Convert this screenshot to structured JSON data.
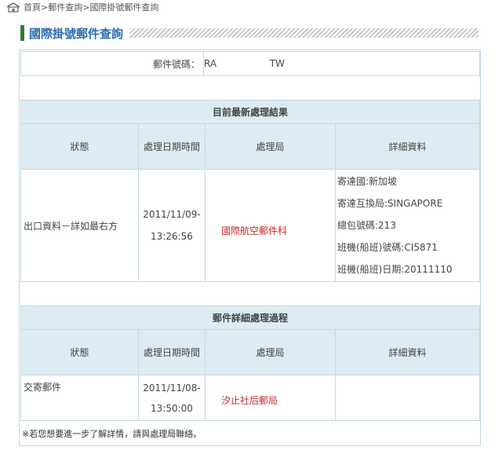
{
  "breadcrumb": {
    "items": [
      "首頁",
      "郵件查詢",
      "國際掛號郵件查詢"
    ],
    "separator": ">"
  },
  "page_title": "國際掛號郵件查詢",
  "query": {
    "label": "郵件號碼：",
    "value_prefix": "RA",
    "value_suffix": "TW"
  },
  "latest": {
    "title": "目前最新處理結果",
    "headers": [
      "狀態",
      "處理日期時間",
      "處理局",
      "詳細資料"
    ],
    "row": {
      "status": "出口資料－詳如最右方",
      "date": "2011/11/09-",
      "time": "13:26:56",
      "office": "國際航空郵件科",
      "details": [
        "寄達國:新加坡",
        "寄達互換局:SINGAPORE",
        "總包號碼:213",
        "班機(船班)號碼:CI5871",
        "班機(船班)日期:20111110"
      ]
    }
  },
  "history": {
    "title": "郵件詳細處理過程",
    "headers": [
      "狀態",
      "處理日期時間",
      "處理局",
      "詳細資料"
    ],
    "rows": [
      {
        "status": "交寄郵件",
        "date": "2011/11/08-",
        "time": "13:50:00",
        "office": "汐止社后郵局",
        "details": ""
      }
    ]
  },
  "note": "※若您想要進一步了解詳情，請與處理局聯絡。",
  "colors": {
    "border": "#c4d9e3",
    "header_bg": "#ddecf3",
    "section_title": "#1f7a1f",
    "page_title": "#2b6cb0",
    "office_text": "#c62828"
  }
}
